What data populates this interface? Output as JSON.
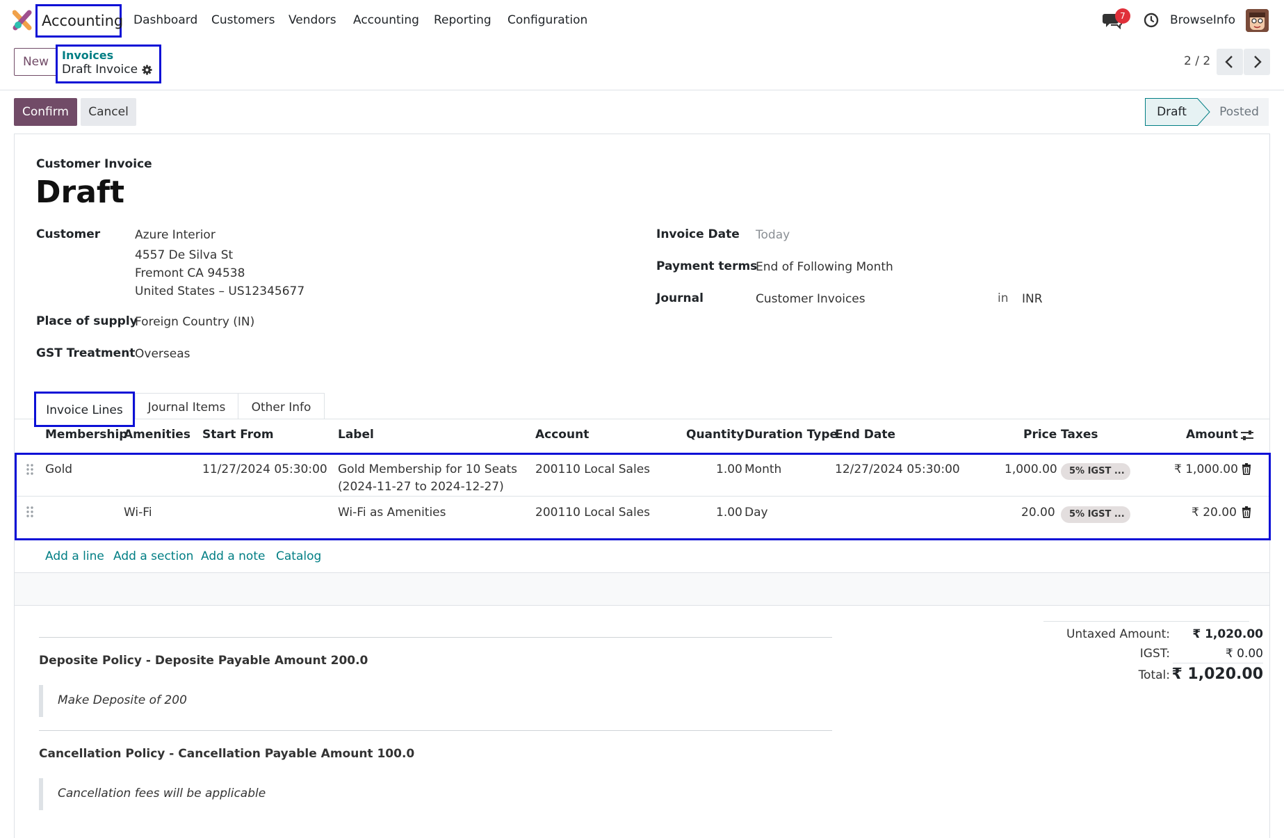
{
  "topnav": {
    "app_name": "Accounting",
    "menu": [
      "Dashboard",
      "Customers",
      "Vendors",
      "Accounting",
      "Reporting",
      "Configuration"
    ],
    "chat_badge": "7",
    "company": "BrowseInfo"
  },
  "control_panel": {
    "new_label": "New",
    "breadcrumb_parent": "Invoices",
    "breadcrumb_current": "Draft Invoice",
    "pager": "2 / 2"
  },
  "statusbar": {
    "confirm_label": "Confirm",
    "cancel_label": "Cancel",
    "stages": [
      "Draft",
      "Posted"
    ],
    "active_stage": "Draft"
  },
  "form": {
    "doc_type": "Customer Invoice",
    "name": "Draft",
    "customer_label": "Customer",
    "customer_name": "Azure Interior",
    "customer_address": [
      "4557 De Silva St",
      "Fremont CA 94538",
      "United States – US12345677"
    ],
    "place_of_supply_label": "Place of supply",
    "place_of_supply": "Foreign Country (IN)",
    "gst_treatment_label": "GST Treatment",
    "gst_treatment": "Overseas",
    "invoice_date_label": "Invoice Date",
    "invoice_date_placeholder": "Today",
    "payment_terms_label": "Payment terms",
    "payment_terms": "End of Following Month",
    "journal_label": "Journal",
    "journal": "Customer Invoices",
    "journal_in": "in",
    "currency": "INR"
  },
  "tabs": [
    "Invoice Lines",
    "Journal Items",
    "Other Info"
  ],
  "lines": {
    "columns": [
      "Membership",
      "Amenities",
      "Start From",
      "Label",
      "Account",
      "Quantity",
      "Duration Type",
      "End Date",
      "Price",
      "Taxes",
      "Amount"
    ],
    "rows": [
      {
        "membership": "Gold",
        "amenities": "",
        "start_from": "11/27/2024 05:30:00",
        "label_line1": "Gold Membership for 10 Seats",
        "label_line2": "(2024-11-27 to 2024-12-27)",
        "account": "200110 Local Sales",
        "quantity": "1.00",
        "duration_type": "Month",
        "end_date": "12/27/2024 05:30:00",
        "price": "1,000.00",
        "taxes": "5% IGST ...",
        "amount": "₹ 1,000.00"
      },
      {
        "membership": "",
        "amenities": "Wi-Fi",
        "start_from": "",
        "label_line1": "Wi-Fi as Amenities",
        "label_line2": "",
        "account": "200110 Local Sales",
        "quantity": "1.00",
        "duration_type": "Day",
        "end_date": "",
        "price": "20.00",
        "taxes": "5% IGST ...",
        "amount": "₹ 20.00"
      }
    ],
    "add_links": [
      "Add a line",
      "Add a section",
      "Add a note",
      "Catalog"
    ]
  },
  "policies": [
    {
      "title": "Deposite Policy - Deposite Payable Amount 200.0",
      "text": "Make Deposite of 200"
    },
    {
      "title": "Cancellation Policy - Cancellation Payable Amount 100.0",
      "text": "Cancellation fees will be applicable"
    }
  ],
  "totals": {
    "untaxed_label": "Untaxed Amount:",
    "untaxed": "₹ 1,020.00",
    "igst_label": "IGST:",
    "igst": "₹ 0.00",
    "total_label": "Total:",
    "total": "₹ 1,020.00"
  },
  "colors": {
    "brand": "#714b67",
    "link": "#017e84",
    "highlight_box": "#0c10d6",
    "badge": "#e0303a"
  }
}
